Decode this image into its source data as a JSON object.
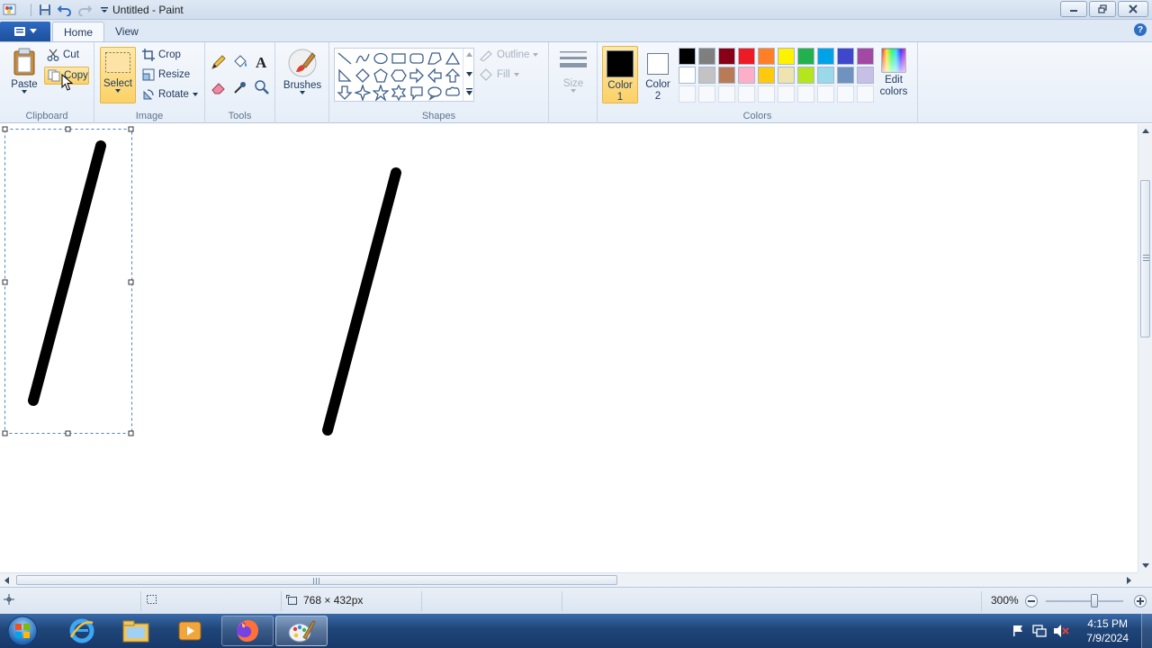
{
  "window": {
    "title": "Untitled - Paint"
  },
  "tabs": {
    "file_icon": "paint-menu-icon",
    "home": "Home",
    "view": "View",
    "help": "?"
  },
  "ribbon": {
    "clipboard": {
      "paste": "Paste",
      "cut": "Cut",
      "copy": "Copy",
      "label": "Clipboard"
    },
    "image": {
      "select": "Select",
      "crop": "Crop",
      "resize": "Resize",
      "rotate": "Rotate",
      "label": "Image"
    },
    "tools": {
      "label": "Tools"
    },
    "brushes": {
      "label": "Brushes"
    },
    "shapes": {
      "outline": "Outline",
      "fill": "Fill",
      "label": "Shapes"
    },
    "size": {
      "label": "Size"
    },
    "colors": {
      "color1_line1": "Color",
      "color1_line2": "1",
      "color2_line1": "Color",
      "color2_line2": "2",
      "edit_line1": "Edit",
      "edit_line2": "colors",
      "label": "Colors",
      "color1_value": "#000000",
      "color2_value": "#ffffff",
      "palette_row1": [
        "#000000",
        "#7f7f7f",
        "#880015",
        "#ed1c24",
        "#ff7f27",
        "#fff200",
        "#22b14c",
        "#00a2e8",
        "#3f48cc",
        "#a349a4"
      ],
      "palette_row2": [
        "#ffffff",
        "#c3c3c3",
        "#b97a57",
        "#ffaec9",
        "#ffc90e",
        "#efe4b0",
        "#b5e61d",
        "#99d9ea",
        "#7092be",
        "#c8bfe7"
      ]
    }
  },
  "status": {
    "canvas_size": "768 × 432px",
    "zoom": "300%"
  },
  "taskbar": {
    "time": "4:15 PM",
    "date": "7/9/2024"
  }
}
